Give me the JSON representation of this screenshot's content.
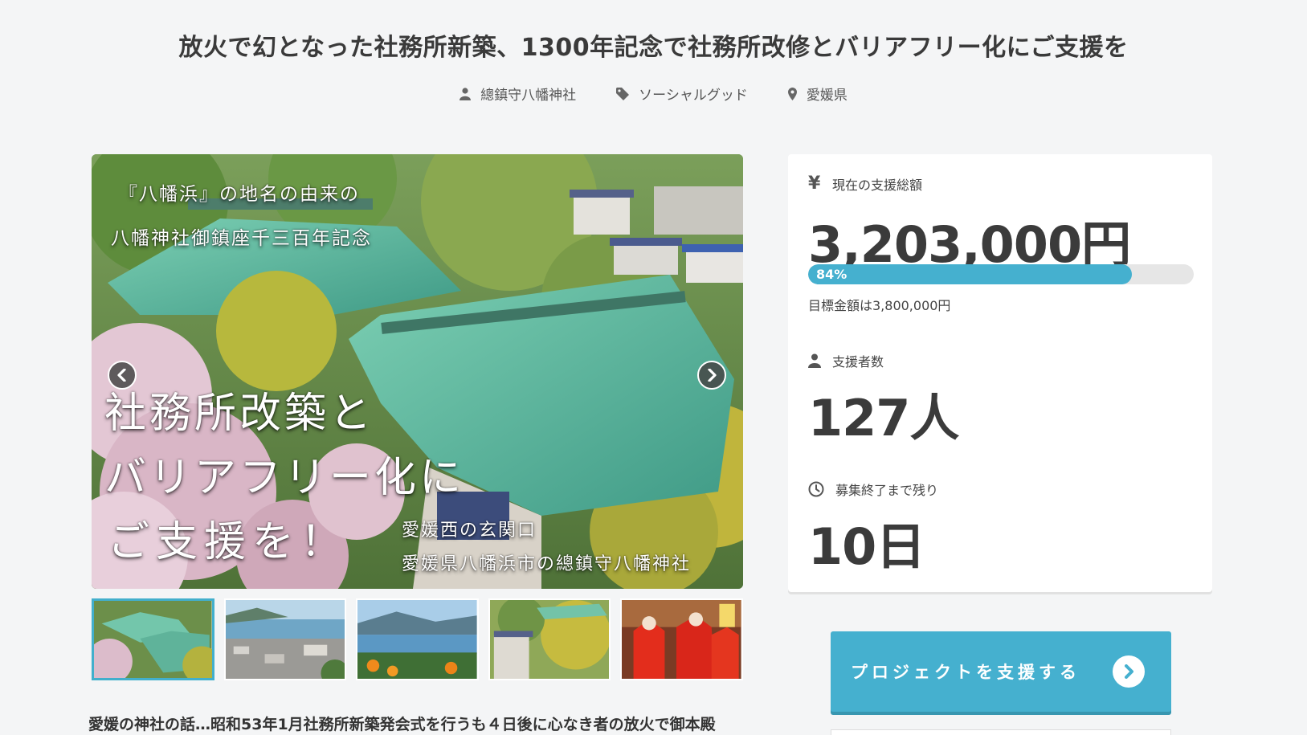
{
  "project": {
    "title": "放火で幻となった社務所新築、1300年記念で社務所改修とバリアフリー化にご支援を",
    "owner": "總鎮守八幡神社",
    "category": "ソーシャルグッド",
    "location": "愛媛県",
    "summary": "愛媛の神社の話…昭和53年1月社務所新築発会式を行うも４日後に心なき者の放火で御本殿"
  },
  "hero_image": {
    "overlay_top1": "『八幡浜』の地名の由来の",
    "overlay_top2": "八幡神社御鎮座千三百年記念",
    "overlay_big1": "社務所改築と",
    "overlay_big2": "バリアフリー化に",
    "overlay_big3": "ご支援を！",
    "overlay_small1": "愛媛西の玄関口",
    "overlay_small2": "愛媛県八幡浜市の總鎮守八幡神社",
    "prev_icon": "chevron-left-icon",
    "next_icon": "chevron-right-icon"
  },
  "thumbnails": [
    {
      "name": "shrine-roof",
      "active": true
    },
    {
      "name": "harbor-town",
      "active": false
    },
    {
      "name": "bay-view",
      "active": false
    },
    {
      "name": "shrine-grounds",
      "active": false
    },
    {
      "name": "festival",
      "active": false
    }
  ],
  "stats": {
    "amount_label": "現在の支援総額",
    "amount": "3,203,000円",
    "progress_percent": 84,
    "progress_label": "84%",
    "goal_text": "目標金額は3,800,000円",
    "backers_label": "支援者数",
    "backers": "127人",
    "remaining_label": "募集終了まで残り",
    "remaining": "10日"
  },
  "support_button": {
    "label": "プロジェクトを支援する"
  },
  "colors": {
    "accent": "#45b0cf",
    "background": "#f4f5f6",
    "text": "#333333"
  }
}
